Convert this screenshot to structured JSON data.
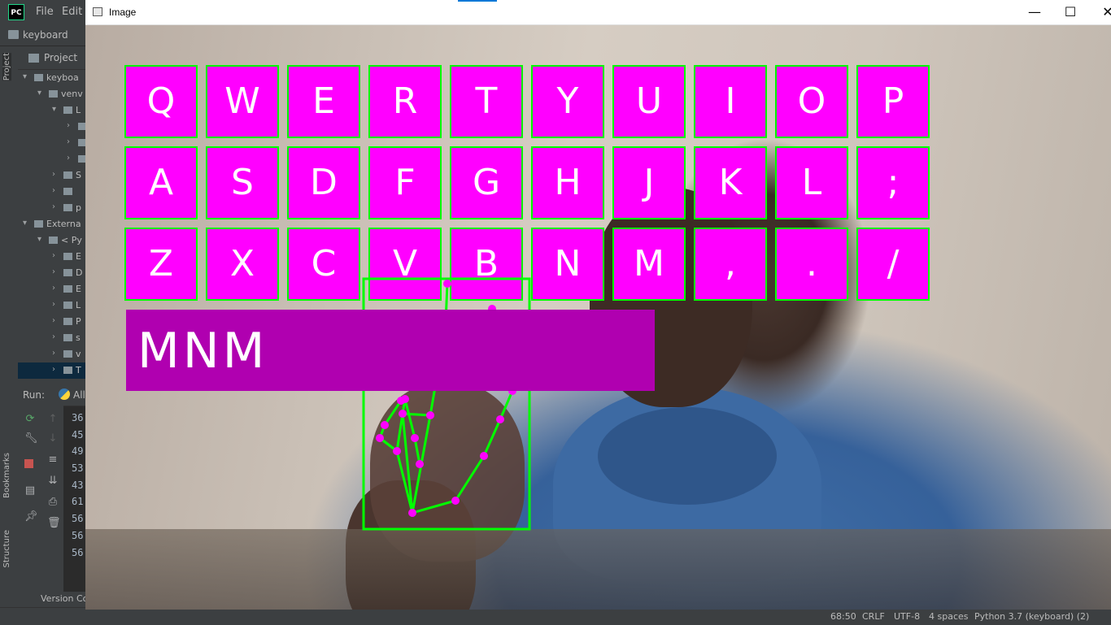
{
  "ide": {
    "menu": [
      "File",
      "Edit"
    ],
    "project_name": "keyboard",
    "panel_title": "Project",
    "side_tabs": [
      "Project",
      "Bookmarks",
      "Structure"
    ],
    "tree": [
      {
        "label": "keyboa",
        "indent": 0,
        "open": true,
        "selected": false
      },
      {
        "label": "venv",
        "indent": 1,
        "open": true,
        "selected": false
      },
      {
        "label": "L",
        "indent": 2,
        "open": true,
        "selected": false
      },
      {
        "label": "",
        "indent": 3,
        "open": false,
        "selected": false
      },
      {
        "label": "",
        "indent": 3,
        "open": false,
        "selected": false
      },
      {
        "label": "",
        "indent": 3,
        "open": false,
        "selected": false
      },
      {
        "label": "S",
        "indent": 2,
        "open": false,
        "selected": false
      },
      {
        "label": "",
        "indent": 2,
        "open": false,
        "selected": false
      },
      {
        "label": "p",
        "indent": 2,
        "open": false,
        "selected": false
      },
      {
        "label": "Externa",
        "indent": 0,
        "open": true,
        "selected": false
      },
      {
        "label": "< Py",
        "indent": 1,
        "open": true,
        "selected": false
      },
      {
        "label": "E",
        "indent": 2,
        "open": false,
        "selected": false
      },
      {
        "label": "D",
        "indent": 2,
        "open": false,
        "selected": false
      },
      {
        "label": "E",
        "indent": 2,
        "open": false,
        "selected": false
      },
      {
        "label": "L",
        "indent": 2,
        "open": false,
        "selected": false
      },
      {
        "label": "P",
        "indent": 2,
        "open": false,
        "selected": false
      },
      {
        "label": "s",
        "indent": 2,
        "open": false,
        "selected": false
      },
      {
        "label": "v",
        "indent": 2,
        "open": false,
        "selected": false
      },
      {
        "label": "T",
        "indent": 2,
        "open": false,
        "selected": true
      }
    ],
    "run_label": "Run:",
    "run_tab": "All",
    "run_lines": [
      "36",
      "45",
      "49",
      "53",
      "43",
      "61",
      "56",
      "56",
      "56"
    ],
    "version_control": "Version Co",
    "status": {
      "position": "68:50",
      "line_sep": "CRLF",
      "encoding": "UTF-8",
      "indent": "4 spaces",
      "interpreter": "Python 3.7 (keyboard) (2)"
    }
  },
  "window": {
    "title": "Image",
    "minimize": "—",
    "maximize": "☐",
    "close": "✕"
  },
  "keyboard": {
    "rows": [
      [
        "Q",
        "W",
        "E",
        "R",
        "T",
        "Y",
        "U",
        "I",
        "O",
        "P"
      ],
      [
        "A",
        "S",
        "D",
        "F",
        "G",
        "H",
        "J",
        "K",
        "L",
        ";"
      ],
      [
        "Z",
        "X",
        "C",
        "V",
        "B",
        "N",
        "M",
        ",",
        ".",
        "/"
      ]
    ],
    "typed_text": "MNM",
    "colors": {
      "key_fill": "#ff00ff",
      "key_border": "#00ff00",
      "text_box": "#b000b0",
      "landmark": "#ff00ff",
      "connection": "#00ff00"
    }
  }
}
